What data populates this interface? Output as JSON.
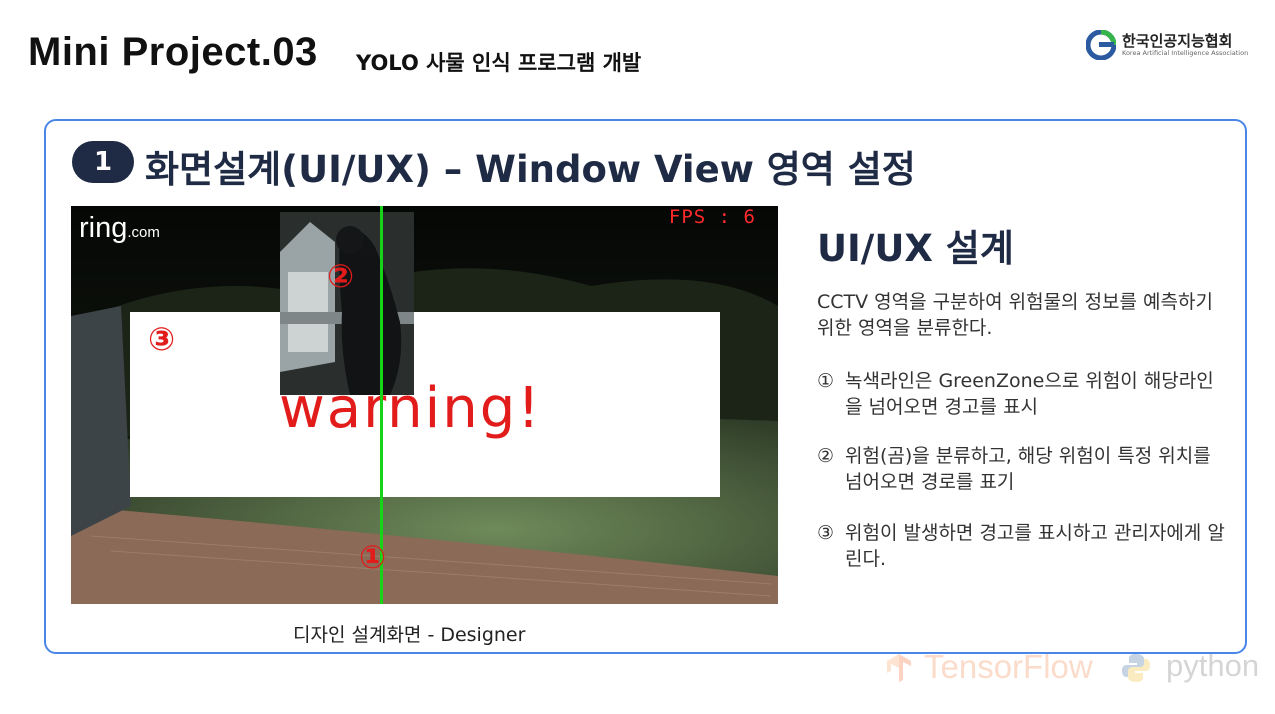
{
  "header": {
    "title": "Mini Project.03",
    "subtitle": "YOLO 사물 인식 프로그램 개발",
    "logo": {
      "name_ko": "한국인공지능협회",
      "name_en": "Korea Artificial Intelligence Association",
      "icon": "kaia-logo-icon"
    }
  },
  "section": {
    "number": "1",
    "title": "화면설계(UI/UX) – Window View 영역 설정"
  },
  "camera_view": {
    "brand_logo": "ring",
    "brand_suffix": ".com",
    "fps_label": "FPS : 6",
    "warning_text": "warning!",
    "markers": {
      "m1": "①",
      "m2": "②",
      "m3": "③"
    },
    "caption": "디자인 설계화면 - Designer",
    "colors": {
      "greenzone_line": "#18d418",
      "warning": "#e21b1b"
    }
  },
  "description": {
    "heading": "UI/UX 설계",
    "intro": "CCTV 영역을 구분하여 위험물의 정보를 예측하기 위한 영역을 분류한다.",
    "items": [
      {
        "num": "①",
        "text": "녹색라인은 GreenZone으로 위험이 해당라인을 넘어오면 경고를 표시"
      },
      {
        "num": "②",
        "text": "위험(곰)을 분류하고, 해당 위험이 특정 위치를 넘어오면 경로를 표기"
      },
      {
        "num": "③",
        "text": "위험이 발생하면 경고를 표시하고 관리자에게 알린다."
      }
    ]
  },
  "footer": {
    "tensorflow_label": "TensorFlow",
    "python_label": "python",
    "icons": [
      "tensorflow-icon",
      "python-icon"
    ]
  },
  "theme": {
    "accent": "#4a86e8",
    "navy": "#1f2a44"
  }
}
